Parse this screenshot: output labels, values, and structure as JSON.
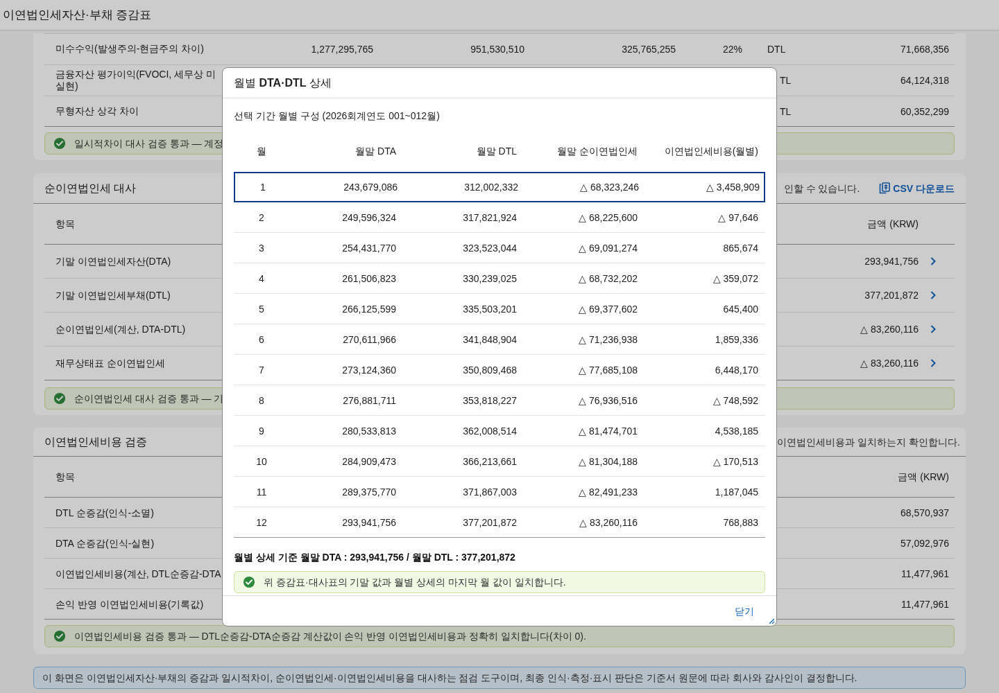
{
  "window": {
    "title": "이연법인세자산·부채 증감표"
  },
  "temporary_differences": {
    "rows": [
      {
        "label": "미수수익(발생주의-현금주의 차이)",
        "column_2": "1,277,295,765",
        "column_3": "951,530,510",
        "column_4": "325,765,255",
        "rate": "22%",
        "type": "DTL",
        "amount": "71,668,356"
      },
      {
        "label": "금융자산 평가이익(FVOCI, 세무상 미실현)",
        "type": "TL",
        "amount": "64,124,318"
      },
      {
        "label": "무형자산 상각 차이",
        "type": "TL",
        "amount": "60,352,299"
      }
    ],
    "banner": {
      "kind": "success",
      "text": "일시적차이 대사 검증 통과 — 계정"
    }
  },
  "net_deferred_tax": {
    "title": "순이연법인세 대사",
    "note": "인할 수 있습니다.",
    "csv_button": "CSV 다운로드",
    "columns": [
      "항목",
      "금액 (KRW)"
    ],
    "rows": [
      {
        "label": "기말 이연법인세자산(DTA)",
        "amount": "293,941,756"
      },
      {
        "label": "기말 이연법인세부채(DTL)",
        "amount": "377,201,872"
      },
      {
        "label": "순이연법인세(계산, DTA-DTL)",
        "amount": "△ 83,260,116"
      },
      {
        "label": "재무상태표 순이연법인세",
        "amount": "△ 83,260,116"
      }
    ],
    "banner": {
      "kind": "success",
      "text": "순이연법인세 대사 검증 통과 — 기"
    }
  },
  "deferred_tax_expense": {
    "title": "이연법인세비용 검증",
    "note": "이연법인세비용과 일치하는지 확인합니다.",
    "columns": [
      "항목",
      "금액 (KRW)"
    ],
    "rows": [
      {
        "label": "DTL 순증감(인식-소멸)",
        "amount": "68,570,937"
      },
      {
        "label": "DTA 순증감(인식-실현)",
        "amount": "57,092,976"
      },
      {
        "label": "이연법인세비용(계산, DTL순증감-DTA",
        "amount": "11,477,961"
      },
      {
        "label": "손익 반영 이연법인세비용(기록값)",
        "amount": "11,477,961"
      }
    ],
    "banner": {
      "kind": "success",
      "text": "이연법인세비용 검증 통과 — DTL순증감-DTA순증감 계산값이 손익 반영 이연법인세비용과 정확히 일치합니다(차이 0)."
    }
  },
  "info_bar": {
    "kind": "info",
    "text": "이 화면은 이연법인세자산·부채의 증감과 일시적차이, 순이연법인세·이연법인세비용을 대사하는 점검 도구이며, 최종 인식·측정·표시 판단은 기준서 원문에 따라 회사와 감사인이 결정합니다."
  },
  "dialog": {
    "title": "월별 **DTA·DTL** 상세",
    "subtitle": "선택 기간 월별 구성 (2026회계연도 001~012월)",
    "columns": [
      "월",
      "월말 DTA",
      "월말 DTL",
      "월말 순이연법인세",
      "이연법인세비용(월별)"
    ],
    "rows": [
      {
        "selected": true,
        "cells": [
          "1",
          "243,679,086",
          "312,002,332",
          "△ 68,323,246",
          "△ 3,458,909"
        ]
      },
      {
        "selected": false,
        "cells": [
          "2",
          "249,596,324",
          "317,821,924",
          "△ 68,225,600",
          "△ 97,646"
        ]
      },
      {
        "selected": false,
        "cells": [
          "3",
          "254,431,770",
          "323,523,044",
          "△ 69,091,274",
          "865,674"
        ]
      },
      {
        "selected": false,
        "cells": [
          "4",
          "261,506,823",
          "330,239,025",
          "△ 68,732,202",
          "△ 359,072"
        ]
      },
      {
        "selected": false,
        "cells": [
          "5",
          "266,125,599",
          "335,503,201",
          "△ 69,377,602",
          "645,400"
        ]
      },
      {
        "selected": false,
        "cells": [
          "6",
          "270,611,966",
          "341,848,904",
          "△ 71,236,938",
          "1,859,336"
        ]
      },
      {
        "selected": false,
        "cells": [
          "7",
          "273,124,360",
          "350,809,468",
          "△ 77,685,108",
          "6,448,170"
        ]
      },
      {
        "selected": false,
        "cells": [
          "8",
          "276,881,711",
          "353,818,227",
          "△ 76,936,516",
          "△ 748,592"
        ]
      },
      {
        "selected": false,
        "cells": [
          "9",
          "280,533,813",
          "362,008,514",
          "△ 81,474,701",
          "4,538,185"
        ]
      },
      {
        "selected": false,
        "cells": [
          "10",
          "284,909,473",
          "366,213,661",
          "△ 81,304,188",
          "△ 170,513"
        ]
      },
      {
        "selected": false,
        "cells": [
          "11",
          "289,375,770",
          "371,867,003",
          "△ 82,491,233",
          "1,187,045"
        ]
      },
      {
        "selected": false,
        "cells": [
          "12",
          "293,941,756",
          "377,201,872",
          "△ 83,260,116",
          "768,883"
        ]
      }
    ],
    "summary": "월별 상세 기준 월말 DTA : 293,941,756 / 월말 DTL : 377,201,872",
    "banner": {
      "kind": "success",
      "text": "위 증감표·대사표의 기말 값과 월별 상세의 마지막 월 값이 일치합니다."
    },
    "close_button": "닫기"
  }
}
